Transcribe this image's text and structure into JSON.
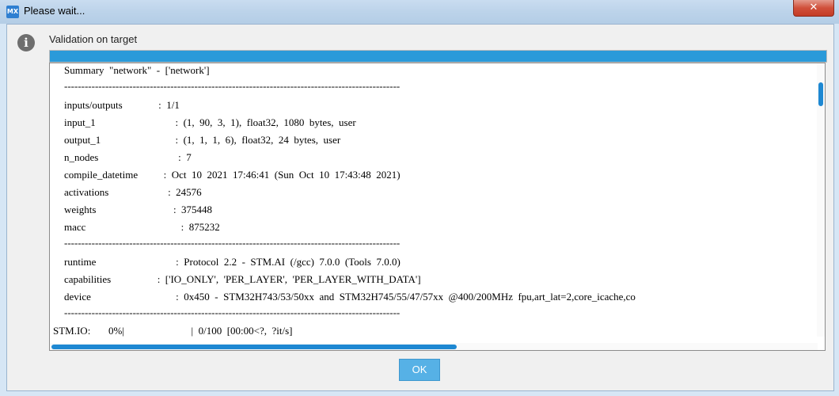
{
  "window": {
    "app_icon": "MX",
    "title": "Please wait...",
    "close_glyph": "✕"
  },
  "header": {
    "icon": "info-icon",
    "label": "Validation on target"
  },
  "progress": {
    "percent": 100,
    "color": "#2a9ad9"
  },
  "console": {
    "lines": [
      "Summary  \"network\"  -  ['network']",
      "--------------------------------------------------------------------------------------------------",
      "inputs/outputs              :  1/1",
      "input_1                               :  (1,  90,  3,  1),  float32,  1080  bytes,  user",
      "output_1                             :  (1,  1,  1,  6),  float32,  24  bytes,  user",
      "n_nodes                               :  7",
      "compile_datetime          :  Oct  10  2021  17:46:41  (Sun  Oct  10  17:43:48  2021)",
      "activations                       :  24576",
      "weights                              :  375448",
      "macc                                     :  875232",
      "--------------------------------------------------------------------------------------------------",
      "runtime                               :  Protocol  2.2  -  STM.AI  (/gcc)  7.0.0  (Tools  7.0.0)",
      "capabilities                  :  ['IO_ONLY',  'PER_LAYER',  'PER_LAYER_WITH_DATA']",
      "device                                 :  0x450  -  STM32H743/53/50xx  and  STM32H745/55/47/57xx  @400/200MHz  fpu,art_lat=2,core_icache,co",
      "--------------------------------------------------------------------------------------------------",
      "STM.IO:       0%|                          |  0/100  [00:00<?,  ?it/s]"
    ]
  },
  "footer": {
    "ok_label": "OK"
  },
  "colors": {
    "accent": "#2a9ad9",
    "ok_button": "#56b1e6",
    "close_button": "#c43c26"
  }
}
